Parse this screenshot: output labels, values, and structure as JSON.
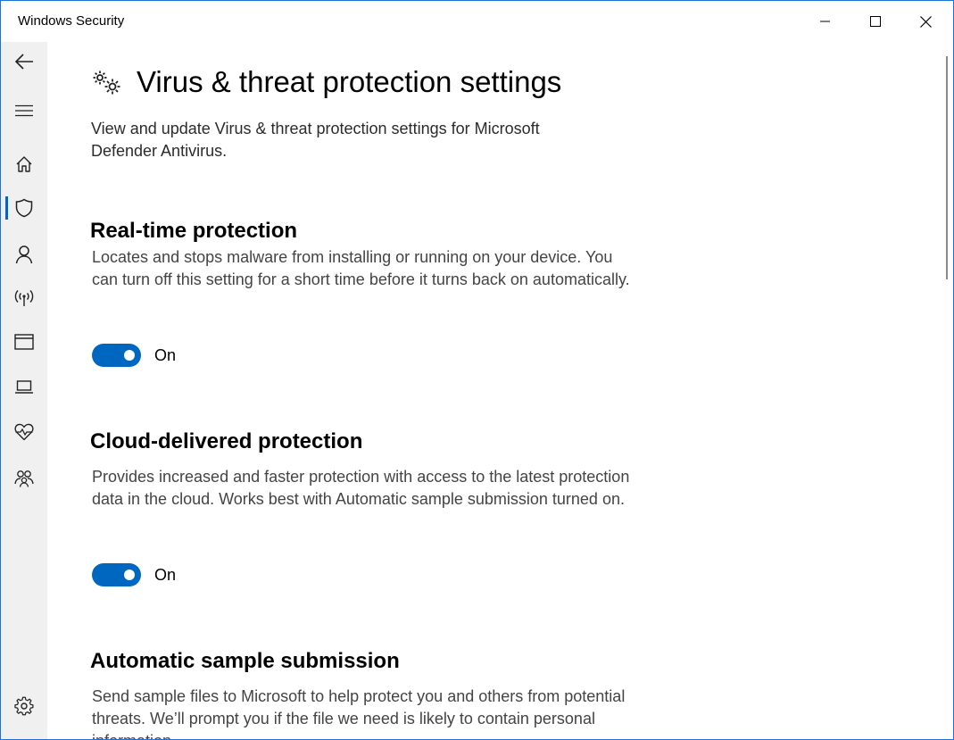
{
  "window": {
    "title": "Windows Security",
    "controls": [
      "minimize-icon",
      "maximize-icon",
      "close-icon"
    ]
  },
  "sidebar": {
    "items": [
      {
        "name": "back",
        "icon": "back-arrow-icon"
      },
      {
        "name": "menu",
        "icon": "hamburger-icon"
      },
      {
        "name": "home",
        "icon": "home-icon"
      },
      {
        "name": "virus-threat-protection",
        "icon": "shield-icon",
        "active": true
      },
      {
        "name": "account-protection",
        "icon": "person-icon"
      },
      {
        "name": "firewall-network",
        "icon": "wireless-icon"
      },
      {
        "name": "app-browser-control",
        "icon": "browser-window-icon"
      },
      {
        "name": "device-security",
        "icon": "laptop-icon"
      },
      {
        "name": "device-performance-health",
        "icon": "heart-pulse-icon"
      },
      {
        "name": "family-options",
        "icon": "family-icon"
      },
      {
        "name": "settings",
        "icon": "gear-icon"
      }
    ]
  },
  "page": {
    "title": "Virus & threat protection settings",
    "description": "View and update Virus & threat protection settings for Microsoft Defender Antivirus."
  },
  "sections": [
    {
      "title": "Real-time protection",
      "description": "Locates and stops malware from installing or running on your device. You can turn off this setting for a short time before it turns back on automatically.",
      "toggle_state": "On"
    },
    {
      "title": "Cloud-delivered protection",
      "description": "Provides increased and faster protection with access to the latest protection data in the cloud. Works best with Automatic sample submission turned on.",
      "toggle_state": "On"
    },
    {
      "title": "Automatic sample submission",
      "description": "Send sample files to Microsoft to help protect you and others from potential threats. We’ll prompt you if the file we need is likely to contain personal information."
    }
  ],
  "colors": {
    "accent": "#0067c0",
    "window_border": "#1a73d8",
    "sidebar_bg": "#f0f0f0"
  }
}
